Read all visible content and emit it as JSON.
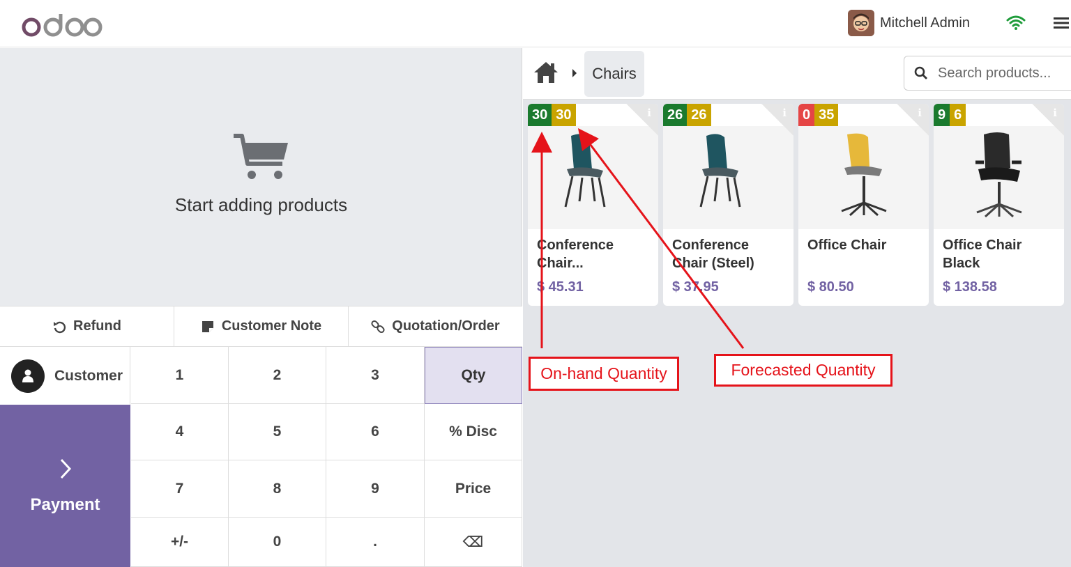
{
  "header": {
    "logo_text": "odoo",
    "user_name": "Mitchell Admin",
    "icons": [
      "avatar",
      "wifi-icon",
      "hamburger-menu-icon"
    ],
    "accent_color": "#714b67"
  },
  "order": {
    "empty_message": "Start adding products",
    "actions": [
      {
        "label": "Refund",
        "icon": "undo-icon"
      },
      {
        "label": "Customer Note",
        "icon": "sticky-note-icon"
      },
      {
        "label": "Quotation/Order",
        "icon": "link-icon"
      }
    ],
    "customer_label": "Customer",
    "payment_label": "Payment",
    "payment_color": "#7262a3"
  },
  "numpad": {
    "keys": [
      "1",
      "2",
      "3",
      "Qty",
      "4",
      "5",
      "6",
      "% Disc",
      "7",
      "8",
      "9",
      "Price",
      "+/-",
      "0",
      ".",
      "⌫"
    ],
    "active_mode": "Qty"
  },
  "products": {
    "breadcrumb": {
      "category": "Chairs"
    },
    "search_placeholder": "Search products...",
    "items": [
      {
        "name": "Conference Chair...",
        "price": "$ 45.31",
        "on_hand": "30",
        "forecast": "30",
        "on_hand_status": "green"
      },
      {
        "name": "Conference Chair (Steel)",
        "price": "$ 37.95",
        "on_hand": "26",
        "forecast": "26",
        "on_hand_status": "green"
      },
      {
        "name": "Office Chair",
        "price": "$ 80.50",
        "on_hand": "0",
        "forecast": "35",
        "on_hand_status": "red"
      },
      {
        "name": "Office Chair Black",
        "price": "$ 138.58",
        "on_hand": "9",
        "forecast": "6",
        "on_hand_status": "green"
      }
    ]
  },
  "annotations": {
    "on_hand_label": "On-hand Quantity",
    "forecast_label": "Forecasted Quantity",
    "color": "#e5131a"
  }
}
